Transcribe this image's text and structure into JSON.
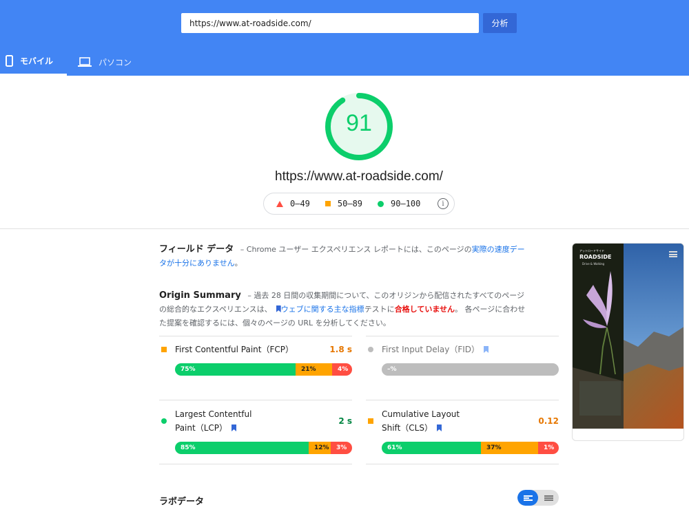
{
  "header": {
    "url_value": "https://www.at-roadside.com/",
    "analyze_label": "分析",
    "tabs": [
      {
        "label": "モバイル",
        "icon": "smartphone-icon",
        "active": true
      },
      {
        "label": "パソコン",
        "icon": "laptop-icon",
        "active": false
      }
    ]
  },
  "score": {
    "value": "91",
    "fraction": 0.91,
    "url": "https://www.at-roadside.com/",
    "color": "#0cce6b",
    "legend": [
      {
        "label": "0–49",
        "marker": "red-triangle"
      },
      {
        "label": "50–89",
        "marker": "orange-square"
      },
      {
        "label": "90–100",
        "marker": "green-circle"
      }
    ]
  },
  "field_data": {
    "title": "フィールド データ",
    "desc_prefix": " – Chrome ユーザー エクスペリエンス レポートには、このページの",
    "desc_link": "実際の速度データが十分にありません",
    "desc_suffix": "。"
  },
  "origin_summary": {
    "title": "Origin Summary",
    "text_1": " – 過去 28 日間の収集期間について、このオリジンから配信されたすべてのページの総合的なエクスペリエンスは、",
    "link": "ウェブに関する主な指標",
    "text_2": "テストに",
    "fail": "合格していません",
    "text_3": "。 各ページに合わせた提案を確認するには、個々のページの URL を分析してください。"
  },
  "metrics": [
    {
      "name": "First Contentful Paint（FCP）",
      "value": "1.8 s",
      "status": "orange",
      "bar": [
        "75%",
        "21%",
        "4%"
      ]
    },
    {
      "name": "First Input Delay（FID）",
      "value": "",
      "status": "grey",
      "bar": [
        "–%"
      ]
    },
    {
      "name_l1": "Largest Contentful",
      "name_l2": "Paint（LCP）",
      "value": "2 s",
      "status": "green",
      "bar": [
        "85%",
        "12%",
        "3%"
      ]
    },
    {
      "name_l1": "Cumulative Layout",
      "name_l2": "Shift（CLS）",
      "value": "0.12",
      "status": "orange",
      "bar": [
        "61%",
        "37%",
        "1%"
      ]
    }
  ],
  "thumbnail": {
    "brand_top": "アットロードサイド",
    "brand": "ROADSIDE",
    "brand_sub": "Drive & Walking"
  },
  "lab_data": {
    "title": "ラボデータ"
  }
}
